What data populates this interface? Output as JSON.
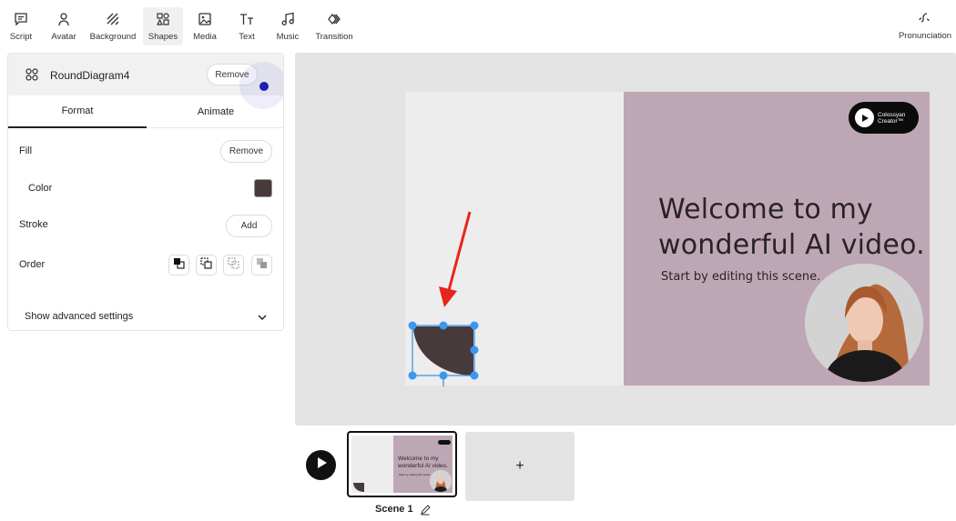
{
  "toolbar": {
    "items": [
      {
        "label": "Script",
        "icon": "script-icon"
      },
      {
        "label": "Avatar",
        "icon": "avatar-icon"
      },
      {
        "label": "Background",
        "icon": "background-icon"
      },
      {
        "label": "Shapes",
        "icon": "shapes-icon",
        "active": true
      },
      {
        "label": "Media",
        "icon": "media-icon"
      },
      {
        "label": "Text",
        "icon": "text-icon"
      },
      {
        "label": "Music",
        "icon": "music-icon"
      },
      {
        "label": "Transition",
        "icon": "transition-icon"
      }
    ],
    "pronunciation": "Pronunciation"
  },
  "panel": {
    "title": "RoundDiagram4",
    "remove_label": "Remove",
    "tabs": [
      "Format",
      "Animate"
    ],
    "fill_label": "Fill",
    "fill_remove": "Remove",
    "color_label": "Color",
    "color_value": "#473a3a",
    "stroke_label": "Stroke",
    "stroke_add": "Add",
    "order_label": "Order",
    "advanced_label": "Show advanced settings"
  },
  "slide": {
    "headline_line1": "Welcome to my",
    "headline_line2": "wonderful AI video.",
    "subtitle": "Start by editing this scene.",
    "logo_line1": "Colossyan",
    "logo_line2": "Creator™",
    "accent_color": "#bea7b4",
    "shape_color": "#473a3a"
  },
  "timeline": {
    "scene_label": "Scene 1",
    "add_label": "+",
    "thumb_line1": "Welcome to my",
    "thumb_line2": "wonderful AI video."
  }
}
